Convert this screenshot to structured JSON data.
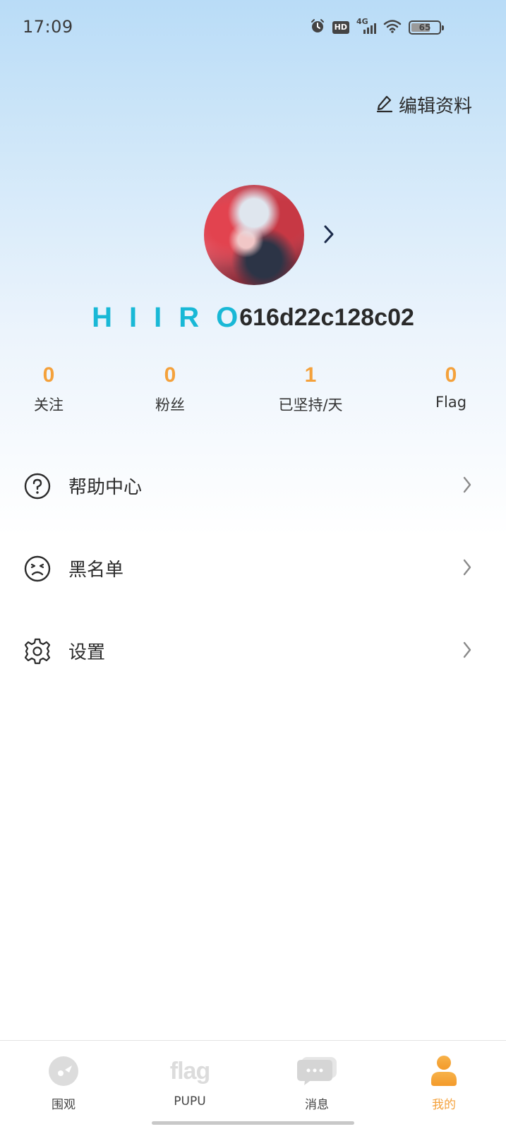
{
  "status_bar": {
    "time": "17:09",
    "hd": "HD",
    "network": "4G",
    "battery": "65",
    "icons": [
      "alarm-icon",
      "hd-icon",
      "signal-icon",
      "wifi-icon",
      "battery-icon"
    ]
  },
  "header": {
    "edit_profile_label": "编辑资料",
    "edit_icon": "pencil-icon"
  },
  "profile": {
    "logo_text": "HIIRO",
    "user_id": "616d22c128c02",
    "chevron_icon": "chevron-right-icon"
  },
  "stats": [
    {
      "value": "0",
      "label": "关注"
    },
    {
      "value": "0",
      "label": "粉丝"
    },
    {
      "value": "1",
      "label": "已坚持/天"
    },
    {
      "value": "0",
      "label": "Flag"
    }
  ],
  "menu": [
    {
      "label": "帮助中心",
      "icon": "help-circle-icon"
    },
    {
      "label": "黑名单",
      "icon": "frown-face-icon"
    },
    {
      "label": "设置",
      "icon": "gear-icon"
    }
  ],
  "tabbar": [
    {
      "label": "围观",
      "icon": "watch-icon",
      "active": false
    },
    {
      "label": "PUPU",
      "icon": "flag-logo-icon",
      "icon_text": "flag",
      "active": false
    },
    {
      "label": "消息",
      "icon": "chat-bubble-icon",
      "active": false
    },
    {
      "label": "我的",
      "icon": "person-icon",
      "active": true
    }
  ],
  "colors": {
    "accent": "#f4a13b",
    "logo": "#19b8d6",
    "header_gradient_top": "#b9dcf7"
  }
}
